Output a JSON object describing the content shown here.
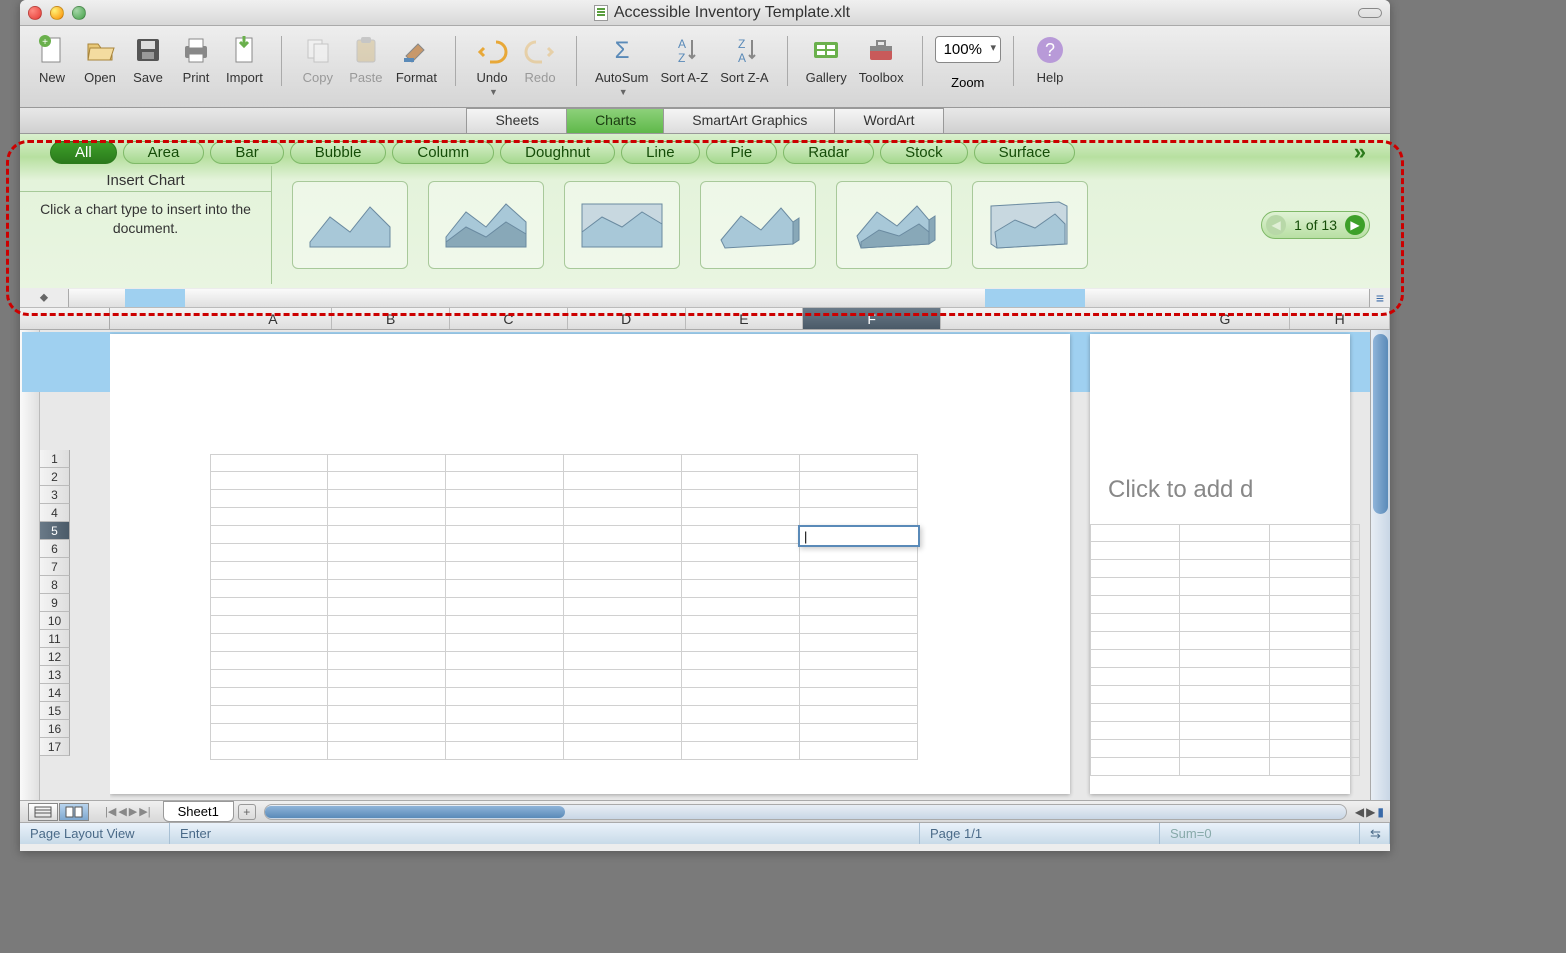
{
  "window": {
    "title": "Accessible Inventory Template.xlt"
  },
  "toolbar": {
    "new": "New",
    "open": "Open",
    "save": "Save",
    "print": "Print",
    "import": "Import",
    "copy": "Copy",
    "paste": "Paste",
    "format": "Format",
    "undo": "Undo",
    "redo": "Redo",
    "autosum": "AutoSum",
    "sortaz": "Sort A-Z",
    "sortza": "Sort Z-A",
    "gallery": "Gallery",
    "toolbox": "Toolbox",
    "zoom_value": "100%",
    "zoom_label": "Zoom",
    "help": "Help"
  },
  "galleryTabs": [
    "Sheets",
    "Charts",
    "SmartArt Graphics",
    "WordArt"
  ],
  "galleryActive": "Charts",
  "chartCats": [
    "All",
    "Area",
    "Bar",
    "Bubble",
    "Column",
    "Doughnut",
    "Line",
    "Pie",
    "Radar",
    "Stock",
    "Surface"
  ],
  "chartCatActive": "All",
  "insertChart": {
    "title": "Insert Chart",
    "desc": "Click a chart type to insert into the document."
  },
  "pager": {
    "text": "1 of 13"
  },
  "columns": [
    "A",
    "B",
    "C",
    "D",
    "E",
    "F",
    "G",
    "H"
  ],
  "selectedCol": "F",
  "rows": [
    "1",
    "2",
    "3",
    "4",
    "5",
    "6",
    "7",
    "8",
    "9",
    "10",
    "11",
    "12",
    "13",
    "14",
    "15",
    "16",
    "17"
  ],
  "selectedRow": "5",
  "placeholder2": "Click to add d",
  "sheetTab": "Sheet1",
  "status": {
    "view": "Page Layout View",
    "mode": "Enter",
    "page": "Page 1/1",
    "sum": "Sum=0"
  }
}
